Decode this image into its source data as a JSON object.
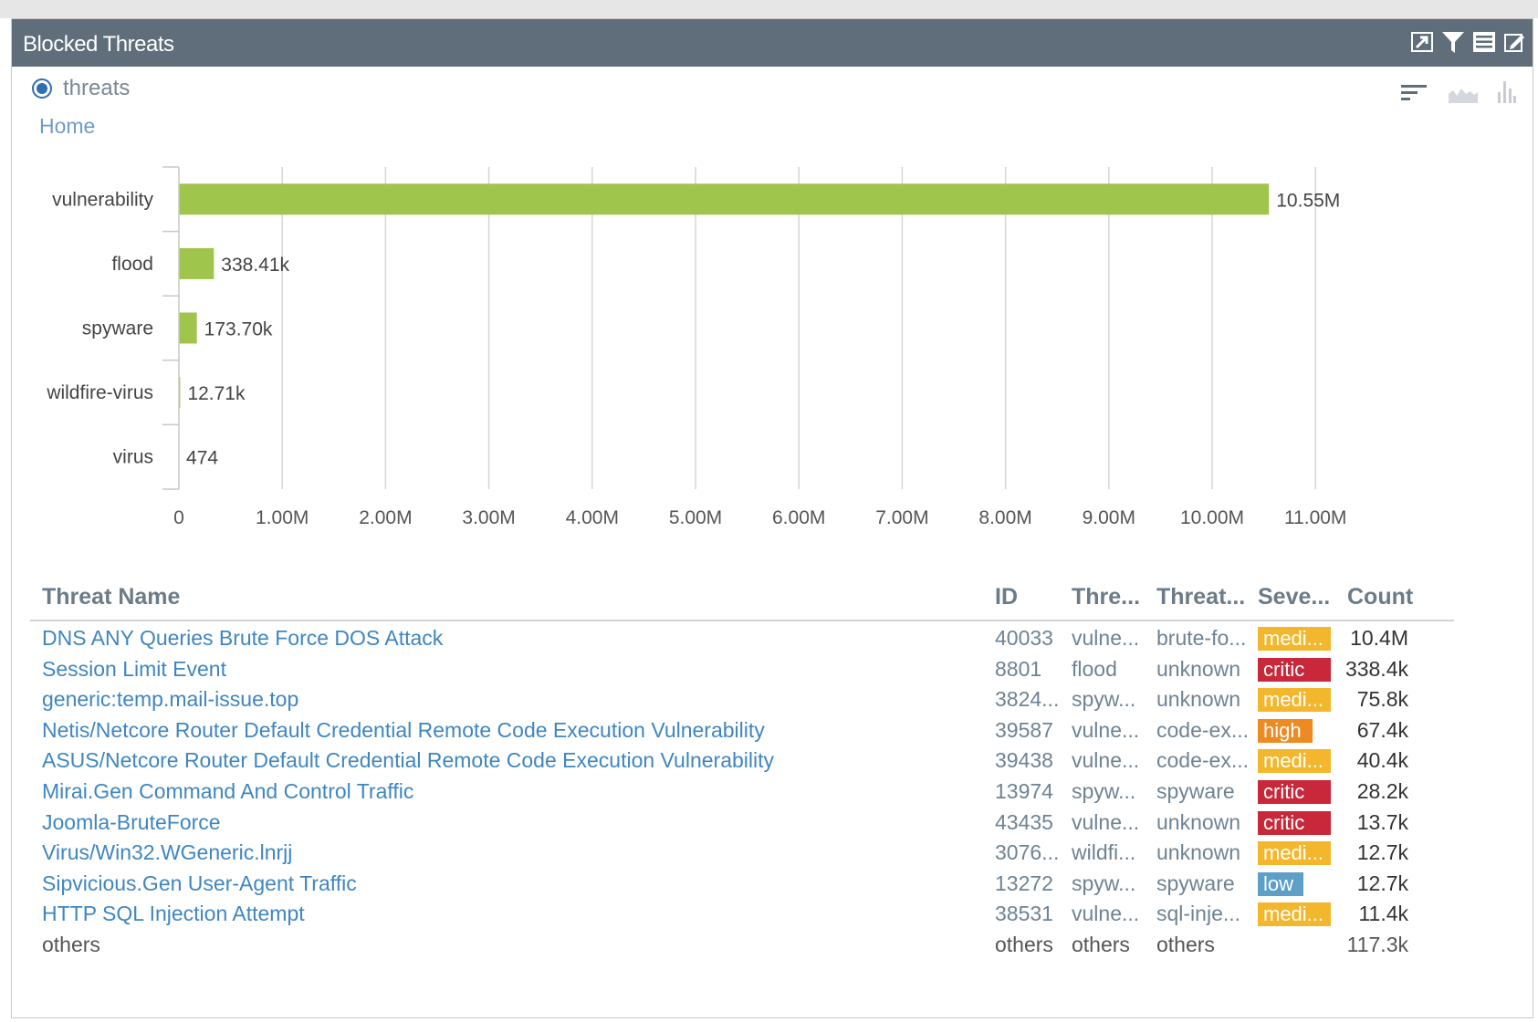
{
  "header": {
    "title": "Blocked Threats"
  },
  "selector": {
    "label": "threats"
  },
  "breadcrumb": {
    "home": "Home"
  },
  "colors": {
    "header_bg": "#5f6e7a",
    "bar": "#9fc54d",
    "link": "#3f86c0",
    "sev_medium": "#f2b72c",
    "sev_critical": "#c9283a",
    "sev_high": "#ee8a22",
    "sev_low": "#5d9fc6"
  },
  "chart_data": {
    "type": "bar",
    "orientation": "horizontal",
    "categories": [
      "vulnerability",
      "flood",
      "spyware",
      "wildfire-virus",
      "virus"
    ],
    "values": [
      10550000,
      338410,
      173700,
      12710,
      474
    ],
    "data_labels": [
      "10.55M",
      "338.41k",
      "173.70k",
      "12.71k",
      "474"
    ],
    "xlim": [
      0,
      11000000
    ],
    "xticks": [
      0,
      1000000,
      2000000,
      3000000,
      4000000,
      5000000,
      6000000,
      7000000,
      8000000,
      9000000,
      10000000,
      11000000
    ],
    "xtick_labels": [
      "0",
      "1.00M",
      "2.00M",
      "3.00M",
      "4.00M",
      "5.00M",
      "6.00M",
      "7.00M",
      "8.00M",
      "9.00M",
      "10.00M",
      "11.00M"
    ],
    "grid": true,
    "title": "",
    "xlabel": "",
    "ylabel": ""
  },
  "table": {
    "headers": {
      "name": "Threat Name",
      "id": "ID",
      "type": "Thre...",
      "category": "Threat...",
      "severity": "Seve...",
      "count": "Count"
    },
    "rows": [
      {
        "name": "DNS ANY Queries Brute Force DOS Attack",
        "id": "40033",
        "type": "vulne...",
        "category": "brute-fo...",
        "severity": "medi...",
        "sev": "medium",
        "count": "10.4M"
      },
      {
        "name": "Session Limit Event",
        "id": "8801",
        "type": "flood",
        "category": "unknown",
        "severity": "critic",
        "sev": "critical",
        "count": "338.4k"
      },
      {
        "name": "generic:temp.mail-issue.top",
        "id": "3824...",
        "type": "spyw...",
        "category": "unknown",
        "severity": "medi...",
        "sev": "medium",
        "count": "75.8k"
      },
      {
        "name": "Netis/Netcore Router Default Credential Remote Code Execution Vulnerability",
        "id": "39587",
        "type": "vulne...",
        "category": "code-ex...",
        "severity": "high",
        "sev": "high",
        "count": "67.4k"
      },
      {
        "name": "ASUS/Netcore Router Default Credential Remote Code Execution Vulnerability",
        "id": "39438",
        "type": "vulne...",
        "category": "code-ex...",
        "severity": "medi...",
        "sev": "medium",
        "count": "40.4k"
      },
      {
        "name": "Mirai.Gen Command And Control Traffic",
        "id": "13974",
        "type": "spyw...",
        "category": "spyware",
        "severity": "critic",
        "sev": "critical",
        "count": "28.2k"
      },
      {
        "name": "Joomla-BruteForce",
        "id": "43435",
        "type": "vulne...",
        "category": "unknown",
        "severity": "critic",
        "sev": "critical",
        "count": "13.7k"
      },
      {
        "name": "Virus/Win32.WGeneric.lnrjj",
        "id": "3076...",
        "type": "wildfi...",
        "category": "unknown",
        "severity": "medi...",
        "sev": "medium",
        "count": "12.7k"
      },
      {
        "name": "Sipvicious.Gen User-Agent Traffic",
        "id": "13272",
        "type": "spyw...",
        "category": "spyware",
        "severity": "low",
        "sev": "low",
        "count": "12.7k"
      },
      {
        "name": "HTTP SQL Injection Attempt",
        "id": "38531",
        "type": "vulne...",
        "category": "sql-inje...",
        "severity": "medi...",
        "sev": "medium",
        "count": "11.4k"
      }
    ],
    "others": {
      "name": "others",
      "id": "others",
      "type": "others",
      "category": "others",
      "count": "117.3k"
    }
  }
}
